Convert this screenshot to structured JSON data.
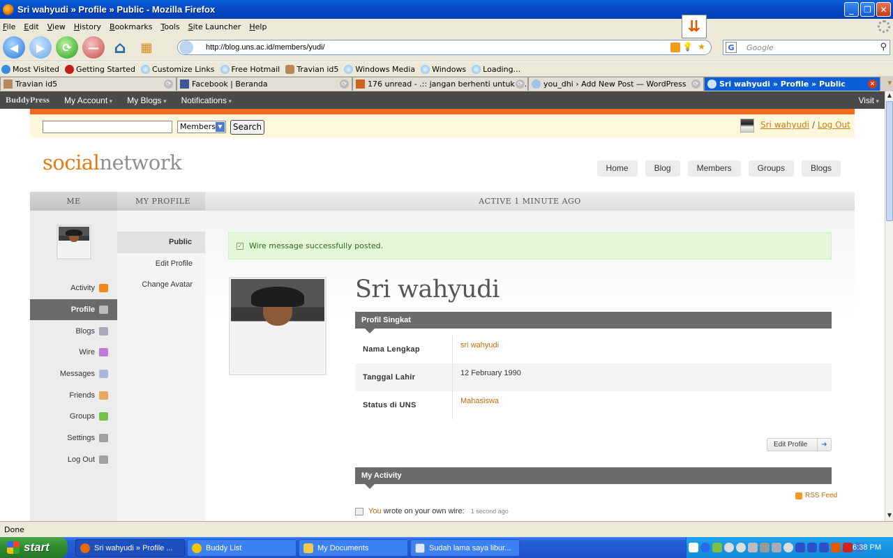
{
  "window": {
    "title": "Sri wahyudi » Profile » Public - Mozilla Firefox"
  },
  "menu": [
    "File",
    "Edit",
    "View",
    "History",
    "Bookmarks",
    "Tools",
    "Site Launcher",
    "Help"
  ],
  "address": {
    "url": "http://blog.uns.ac.id/members/yudi/"
  },
  "search": {
    "placeholder": "Google"
  },
  "bookmarks": [
    "Most Visited",
    "Getting Started",
    "Customize Links",
    "Free Hotmail",
    "Travian id5",
    "Windows Media",
    "Windows",
    "Loading..."
  ],
  "tabs": [
    {
      "label": "Travian id5"
    },
    {
      "label": "Facebook | Beranda"
    },
    {
      "label": "176 unread - .:: jangan berhenti untuk b..."
    },
    {
      "label": "you_dhi › Add New Post — WordPress"
    },
    {
      "label": "Sri wahyudi » Profile » Public"
    }
  ],
  "adminbar": {
    "logo": "BuddyPress",
    "items": [
      "My Account",
      "My Blogs",
      "Notifications"
    ],
    "visit": "Visit"
  },
  "site_search": {
    "select": "Members",
    "button": "Search"
  },
  "user": {
    "name": "Sri wahyudi",
    "separator": "/",
    "logout": "Log Out"
  },
  "logo": {
    "part1": "social",
    "part2": "network"
  },
  "topnav": [
    "Home",
    "Blog",
    "Members",
    "Groups",
    "Blogs"
  ],
  "optionbar": {
    "me": "ME",
    "profile": "MY PROFILE",
    "active": "ACTIVE 1 MINUTE AGO"
  },
  "me_nav": [
    {
      "label": "Activity",
      "icon": "rss-icon",
      "color": "#f0891a"
    },
    {
      "label": "Profile",
      "icon": "profile-icon",
      "color": "#bbbbbb"
    },
    {
      "label": "Blogs",
      "icon": "blog-icon",
      "color": "#a8a8b8"
    },
    {
      "label": "Wire",
      "icon": "wire-icon",
      "color": "#c07ad8"
    },
    {
      "label": "Messages",
      "icon": "envelope-icon",
      "color": "#a8b8d8"
    },
    {
      "label": "Friends",
      "icon": "lock-icon",
      "color": "#e8a862"
    },
    {
      "label": "Groups",
      "icon": "cube-icon",
      "color": "#78c04a"
    },
    {
      "label": "Settings",
      "icon": "wrench-icon",
      "color": "#a0a0a0"
    },
    {
      "label": "Log Out",
      "icon": "padlock-icon",
      "color": "#a0a0a0"
    }
  ],
  "profile_nav": [
    "Public",
    "Edit Profile",
    "Change Avatar"
  ],
  "notice": "Wire message successfully posted.",
  "profile": {
    "name": "Sri wahyudi",
    "section_title": "Profil Singkat",
    "fields": [
      {
        "label": "Nama Lengkap",
        "value": "sri wahyudi"
      },
      {
        "label": "Tanggal Lahir",
        "value": "12 February 1990"
      },
      {
        "label": "Status di UNS",
        "value": "Mahasiswa"
      }
    ],
    "edit_button": "Edit Profile"
  },
  "activity": {
    "title": "My Activity",
    "rss": "RSS Feed",
    "item": {
      "actor": "You",
      "text": "wrote on your own wire:",
      "time": "1 second ago"
    }
  },
  "status": "Done",
  "taskbar": {
    "start": "start",
    "tasks": [
      "Sri wahyudi » Profile ...",
      "Buddy List",
      "My Documents",
      "Sudah lama saya libur..."
    ],
    "clock": "6:38 PM"
  }
}
